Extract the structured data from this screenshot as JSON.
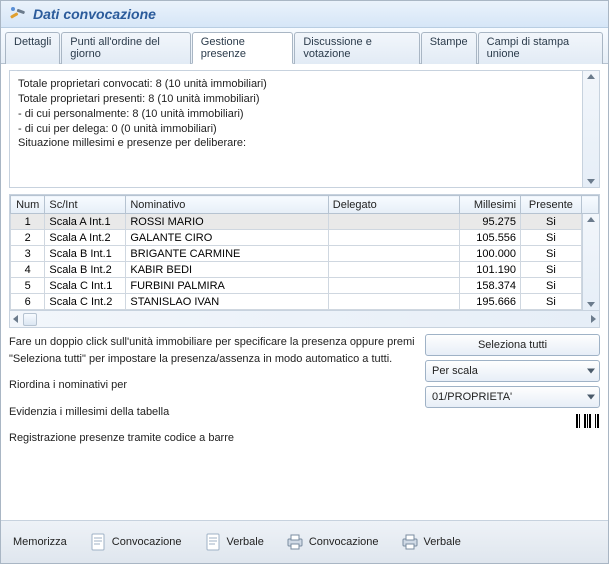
{
  "title": "Dati convocazione",
  "tabs": [
    {
      "label": "Dettagli",
      "active": false
    },
    {
      "label": "Punti all'ordine del giorno",
      "active": false
    },
    {
      "label": "Gestione presenze",
      "active": true
    },
    {
      "label": "Discussione e votazione",
      "active": false
    },
    {
      "label": "Stampe",
      "active": false
    },
    {
      "label": "Campi di stampa unione",
      "active": false
    }
  ],
  "summary": {
    "lines": [
      "Totale proprietari convocati: 8 (10 unità immobiliari)",
      "Totale proprietari presenti: 8 (10 unità immobiliari)",
      "- di cui personalmente: 8 (10 unità immobiliari)",
      "- di cui per delega: 0 (0 unità immobiliari)",
      "",
      "Situazione millesimi e presenze per deliberare:"
    ]
  },
  "grid": {
    "headers": {
      "num": "Num",
      "scint": "Sc/Int",
      "nominativo": "Nominativo",
      "delegato": "Delegato",
      "millesimi": "Millesimi",
      "presente": "Presente"
    },
    "rows": [
      {
        "num": "1",
        "scint": "Scala A Int.1",
        "nominativo": "ROSSI MARIO",
        "delegato": "",
        "millesimi": "95.275",
        "presente": "Si",
        "selected": true
      },
      {
        "num": "2",
        "scint": "Scala A Int.2",
        "nominativo": "GALANTE CIRO",
        "delegato": "",
        "millesimi": "105.556",
        "presente": "Si",
        "selected": false
      },
      {
        "num": "3",
        "scint": "Scala B Int.1",
        "nominativo": "BRIGANTE CARMINE",
        "delegato": "",
        "millesimi": "100.000",
        "presente": "Si",
        "selected": false
      },
      {
        "num": "4",
        "scint": "Scala B Int.2",
        "nominativo": "KABIR BEDI",
        "delegato": "",
        "millesimi": "101.190",
        "presente": "Si",
        "selected": false
      },
      {
        "num": "5",
        "scint": "Scala C Int.1",
        "nominativo": "FURBINI PALMIRA",
        "delegato": "",
        "millesimi": "158.374",
        "presente": "Si",
        "selected": false
      },
      {
        "num": "6",
        "scint": "Scala C Int.2",
        "nominativo": "STANISLAO IVAN",
        "delegato": "",
        "millesimi": "195.666",
        "presente": "Si",
        "selected": false
      }
    ]
  },
  "hints": {
    "doubleclick": "Fare un doppio click sull'unità immobiliare per specificare la presenza oppure premi \"Seleziona tutti\" per impostare la presenza/assenza in modo automatico a tutti.",
    "reorder": "Riordina i nominativi per",
    "highlight": "Evidenzia i millesimi della tabella",
    "barcode": "Registrazione presenze tramite codice a barre"
  },
  "controls": {
    "select_all": "Seleziona tutti",
    "sort_by": "Per scala",
    "table_select": "01/PROPRIETA'"
  },
  "footer": {
    "memorizza": "Memorizza",
    "convocazione_doc": "Convocazione",
    "verbale_doc": "Verbale",
    "convocazione_print": "Convocazione",
    "verbale_print": "Verbale"
  }
}
